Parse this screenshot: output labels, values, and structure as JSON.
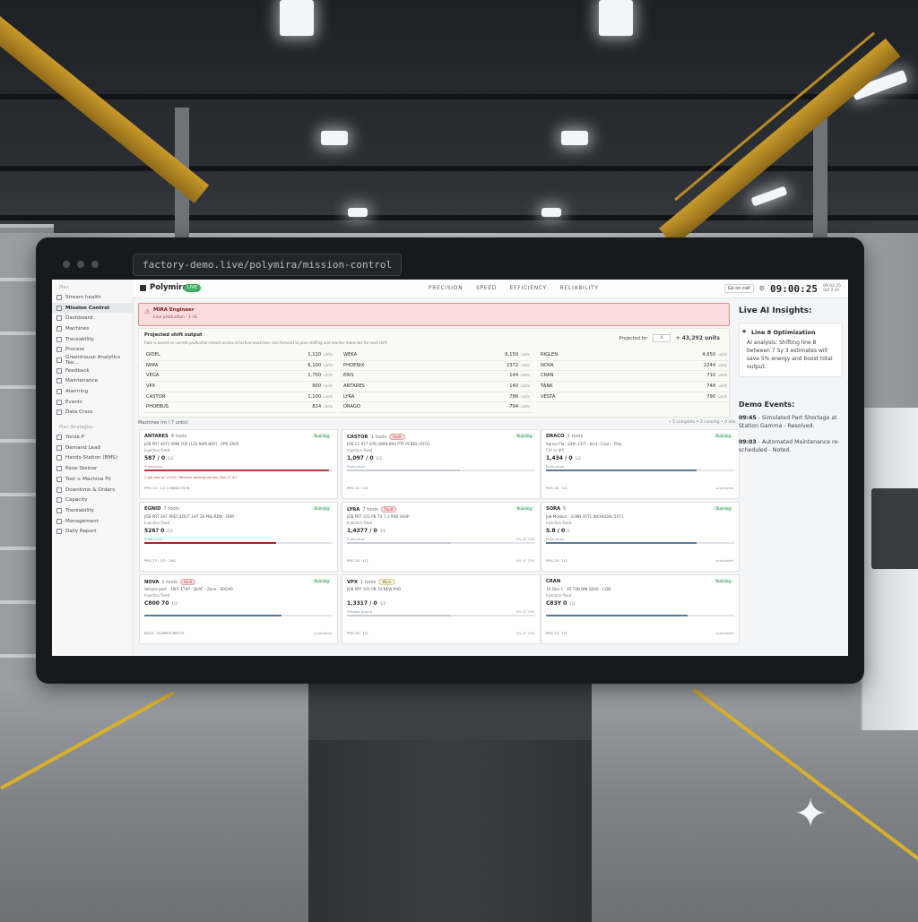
{
  "browser": {
    "url": "factory-demo.live/polymira/mission-control"
  },
  "app": {
    "brand": "Polymira",
    "status_badge": "LIVE"
  },
  "header": {
    "pillars": [
      "PRECISION",
      "SPEED",
      "EFFICIENCY",
      "RELIABILITY"
    ],
    "chip": "Go on call",
    "clock": "09:00:25",
    "meta_line1": "09.02.25",
    "meta_line2": "Sat 2 sh"
  },
  "nav": {
    "section1": "Plan",
    "items1": [
      "Stream health",
      "Mission Control",
      "Dashboard",
      "Machines",
      "Traceability",
      "Process",
      "Greenhouse Analytics Tee...",
      "Feedback",
      "Maintenance",
      "Alarming",
      "Events",
      "Data Cross"
    ],
    "section2": "Plan Strategies",
    "items2": [
      "Yonse P",
      "Demand Lead",
      "Hands-Station (BMS)",
      "Pane Steiner",
      "Tool + Machine Fit",
      "Downtime & Orders",
      "Capacity",
      "Traceability",
      "Management",
      "Daily Report"
    ]
  },
  "alert": {
    "title": "MIRA Engineer",
    "subtitle": "Line production · 1 HL"
  },
  "projected": {
    "title": "Projected shift output",
    "description": "Rate is based on current production trends across all active machines. Use forecast to plan staffing and reorder materials for next shift.",
    "forecast_label": "Projected for",
    "forecast_value": "4",
    "forecast_total": "+ 43,292 units",
    "unit": "units",
    "columns": [
      [
        {
          "name": "GIDEL",
          "value": "1,120"
        },
        {
          "name": "NIMA",
          "value": "6,100"
        },
        {
          "name": "VEGA",
          "value": "1,700"
        },
        {
          "name": "VPX",
          "value": "900"
        },
        {
          "name": "CASTOR",
          "value": "1,100"
        },
        {
          "name": "PHOEBUS",
          "value": "824"
        }
      ],
      [
        {
          "name": "WEKA",
          "value": "6,150"
        },
        {
          "name": "PHOENIX",
          "value": "2372"
        },
        {
          "name": "ERIS",
          "value": "144"
        },
        {
          "name": "ANTARES",
          "value": "140"
        },
        {
          "name": "LYRA",
          "value": "786"
        },
        {
          "name": "DRAGO",
          "value": "794"
        }
      ],
      [
        {
          "name": "RIGLEN",
          "value": "4,650"
        },
        {
          "name": "NOVA",
          "value": "2244"
        },
        {
          "name": "CRAN",
          "value": "710"
        },
        {
          "name": "TANK",
          "value": "748"
        },
        {
          "name": "VESTA",
          "value": "790"
        }
      ]
    ]
  },
  "machines": {
    "header": "Machines (m / 7 units)",
    "right_note": "• 5 complete • 2 running • 0 idle",
    "cards": [
      {
        "name": "ANTARES",
        "tools": "4 tools",
        "badge": "",
        "status": "Running",
        "job": "JOB PRT 40T3 SMN 700 (120 RAM BDY) - PPR 0X05",
        "job2": "Injection fixed",
        "count": "587 / 0",
        "count_unit": "1/2",
        "left": "Production",
        "right": "",
        "progress": 0.98,
        "bar_color": "#b43a3a",
        "note": "1 job due at 13:00 · Reorder parting panels (line 2) #7",
        "foot": "PRG 23 · 1/2 CONNECTION"
      },
      {
        "name": "CASTOR",
        "tools": "1 tools",
        "badge": "Fault",
        "status": "Running",
        "job": "JOB C1 P77 07B SWIN 800 PTP PCBES (RFI2)",
        "job2": "Injection fixed",
        "count": "1,097 / 0",
        "count_unit": "1/3",
        "left": "Production",
        "right": "",
        "progress": 0.6,
        "bar_color": "#c6ccd2",
        "note": "",
        "foot": "PRG 23 · 1/2"
      },
      {
        "name": "DRACO",
        "tools": "1 tools",
        "badge": "",
        "status": "Running",
        "job": "Series Fla · 24th 21/7 - 8nd - Conn - Pilar",
        "job2": "Ctrl to 8th",
        "count": "1,434 / 0",
        "count_unit": "1/2",
        "left": "Production",
        "right": "",
        "progress": 0.8,
        "bar_color": "#5a7a9a",
        "note": "",
        "foot": "PRG 18 · 1/2",
        "foot_right": "scheduled"
      },
      {
        "name": "EGNID",
        "tools": "7 tools",
        "badge": "",
        "status": "Running",
        "job": "JOB PRT 2HT PRECILOUT 1HT 28 PBL-RDN - DRR",
        "job2": "Injection fixed",
        "count": "526? 0",
        "count_unit": "1/3",
        "left": "Production",
        "right": "",
        "progress": 0.7,
        "bar_color": "#9b2a2a",
        "note": "",
        "foot": "PRG 23 · 1/2 · 2HS"
      },
      {
        "name": "LYRA",
        "tools": "7 tools",
        "badge": "Fault",
        "status": "Running",
        "job": "JOB PRT 101 PB 70 7.3 POB 44HP",
        "job2": "Injection fixed",
        "count": "1,4377 / 0",
        "count_unit": "1/2",
        "left": "Production",
        "right": "3% 47 100",
        "progress": 0.55,
        "bar_color": "#c6ccd2",
        "note": "",
        "foot": "PRG 20 · 1/2",
        "foot_right": "3% 47 100"
      },
      {
        "name": "SORA",
        "tools": "6",
        "badge": "",
        "status": "Running",
        "job": "Job Modext · 31MN 10T1 INCHODAL 50T1",
        "job2": "Injection fixed",
        "count": "5.8 / 0",
        "count_unit": "2",
        "left": "Production",
        "right": "",
        "progress": 0.8,
        "bar_color": "#5a7a9a",
        "note": "",
        "foot": "PRG 24 · 1/2",
        "foot_right": "scheduled"
      },
      {
        "name": "NOVA",
        "tools": "1 tools",
        "badge": "Fault",
        "status": "Running",
        "job": "Vehicle port · 18FF 1T4P · DLRF - Zene · ERGAR",
        "job2": "Injection fixed",
        "count": "C800 70",
        "count_unit": "1/2",
        "left": "",
        "right": "",
        "progress": 0.73,
        "bar_color": "#5a7a9a",
        "note": "",
        "foot": "BOCK · BUMPER BIN FIT",
        "foot_right": "scheduled"
      },
      {
        "name": "VPX",
        "tools": "1 tools",
        "badge": "Warn",
        "status": "",
        "job": "JOB PRT 101 PB 70 NEW P0D",
        "job2": "",
        "count": "1,3317 / 0",
        "count_unit": "1/2",
        "left": "Flexible output",
        "right": "3% 47 100",
        "progress": 0.55,
        "bar_color": "#c6ccd2",
        "note": "",
        "foot": "PRG 20 · 1/2",
        "foot_right": "3% 47 100"
      },
      {
        "name": "CRAN",
        "tools": "",
        "badge": "",
        "status": "Running",
        "job": "1A Dev 1 · 95 T0B BIN SEAR - CON",
        "job2": "Injection fixed",
        "count": "C83Y 0",
        "count_unit": "1/2",
        "left": "",
        "right": "",
        "progress": 0.75,
        "bar_color": "#5a7a9a",
        "note": "",
        "foot": "PRG 23 · 1/2",
        "foot_right": "scheduled"
      }
    ]
  },
  "insights": {
    "title": "Live AI Insights:",
    "card_title": "Line 8 Optimization",
    "card_body": "AI analysis: Shifting line 8 between 7 Sy 3 estimates will save 5% energy and boost total output.",
    "events_title": "Demo Events:",
    "events": [
      {
        "time": "09:45",
        "text": "- Simulated Part Shortage at Station Gamma - Resolved."
      },
      {
        "time": "09:03",
        "text": "- Automated Maintenance re-scheduled - Noted."
      }
    ]
  }
}
